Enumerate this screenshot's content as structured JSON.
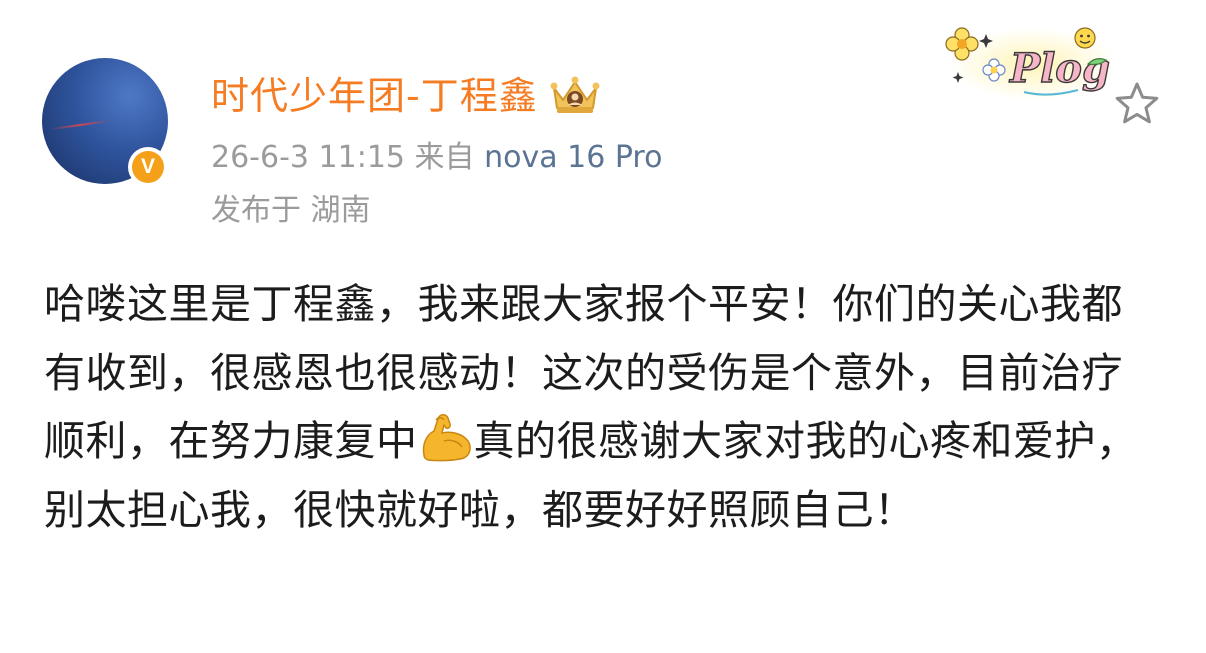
{
  "post": {
    "author": {
      "name": "时代少年团-丁程鑫",
      "verified_badge": "V"
    },
    "meta": {
      "timestamp": "26-6-3 11:15",
      "source_prefix": "来自",
      "device": "nova 16 Pro",
      "location": "发布于 湖南"
    },
    "sticker_text": "Plog",
    "content": {
      "text_before_emoji": "哈喽这里是丁程鑫，我来跟大家报个平安！你们的关心我都有收到，很感恩也很感动！这次的受伤是个意外，目前治疗顺利，在努力康复中",
      "emoji": "flexed-biceps",
      "text_after_emoji": "真的很感谢大家对我的心疼和爱护，别太担心我，很快就好啦，都要好好照顾自己！"
    }
  },
  "colors": {
    "username": "#f57c23",
    "meta_gray": "#9b9b9b",
    "device_link": "#5b7494",
    "body_text": "#1c1c1c",
    "verified_badge": "#f5a019"
  }
}
